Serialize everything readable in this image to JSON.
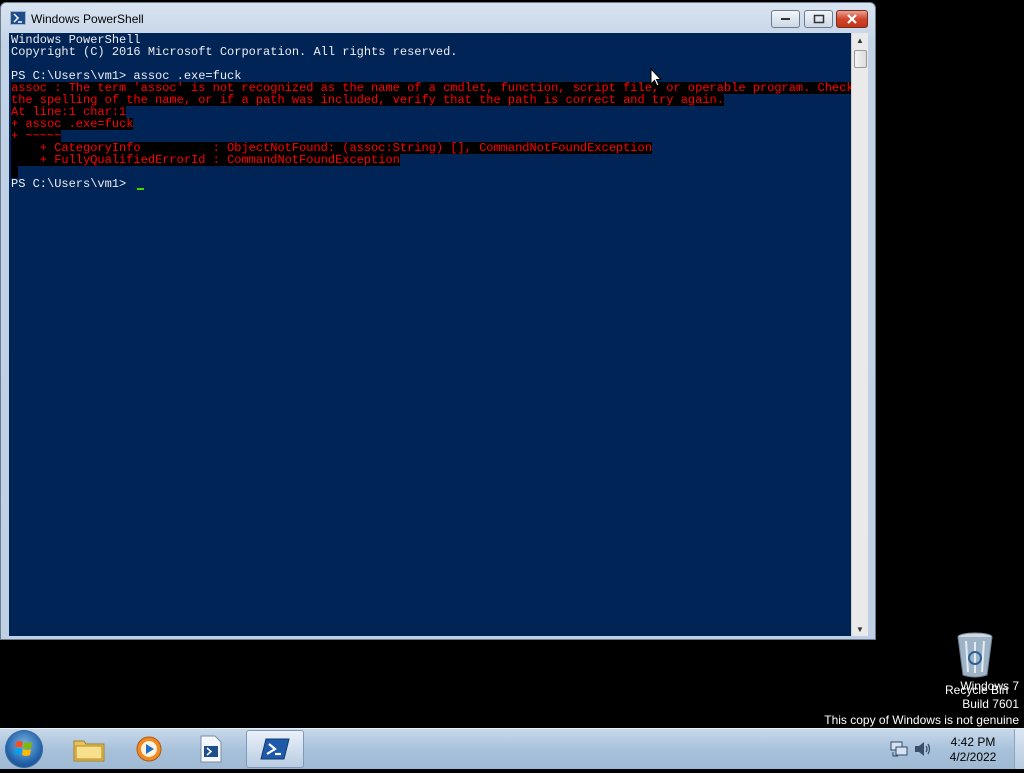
{
  "window": {
    "title": "Windows PowerShell"
  },
  "console": {
    "lines": [
      {
        "text": "Windows PowerShell",
        "style": "normal"
      },
      {
        "text": "Copyright (C) 2016 Microsoft Corporation. All rights reserved.",
        "style": "normal"
      },
      {
        "text": "",
        "style": "normal"
      },
      {
        "text": "PS C:\\Users\\vm1> assoc .exe=fuck",
        "style": "normal"
      },
      {
        "text": "assoc : The term 'assoc' is not recognized as the name of a cmdlet, function, script file, or operable program. Check ",
        "style": "error"
      },
      {
        "text": "the spelling of the name, or if a path was included, verify that the path is correct and try again.",
        "style": "error"
      },
      {
        "text": "At line:1 char:1",
        "style": "error"
      },
      {
        "text": "+ assoc .exe=fuck",
        "style": "error"
      },
      {
        "text": "+ ~~~~~",
        "style": "error"
      },
      {
        "text": "    + CategoryInfo          : ObjectNotFound: (assoc:String) [], CommandNotFoundException",
        "style": "error"
      },
      {
        "text": "    + FullyQualifiedErrorId : CommandNotFoundException",
        "style": "error"
      },
      {
        "text": " ",
        "style": "error"
      },
      {
        "text": "PS C:\\Users\\vm1> ",
        "style": "normal"
      }
    ]
  },
  "desktop": {
    "recycle_bin_label": "Recycle Bin",
    "watermark": {
      "line1": "Windows 7",
      "line2": "Build 7601",
      "line3": "This copy of Windows is not genuine"
    }
  },
  "taskbar": {
    "clock_time": "4:42 PM",
    "clock_date": "4/2/2022",
    "pinned": [
      "windows-explorer",
      "windows-media-player",
      "powershell-ise",
      "windows-powershell"
    ]
  },
  "colors": {
    "console_bg": "#012456",
    "console_fg": "#eeedf0",
    "error_fg": "#ff0000",
    "error_bg": "#000000"
  }
}
